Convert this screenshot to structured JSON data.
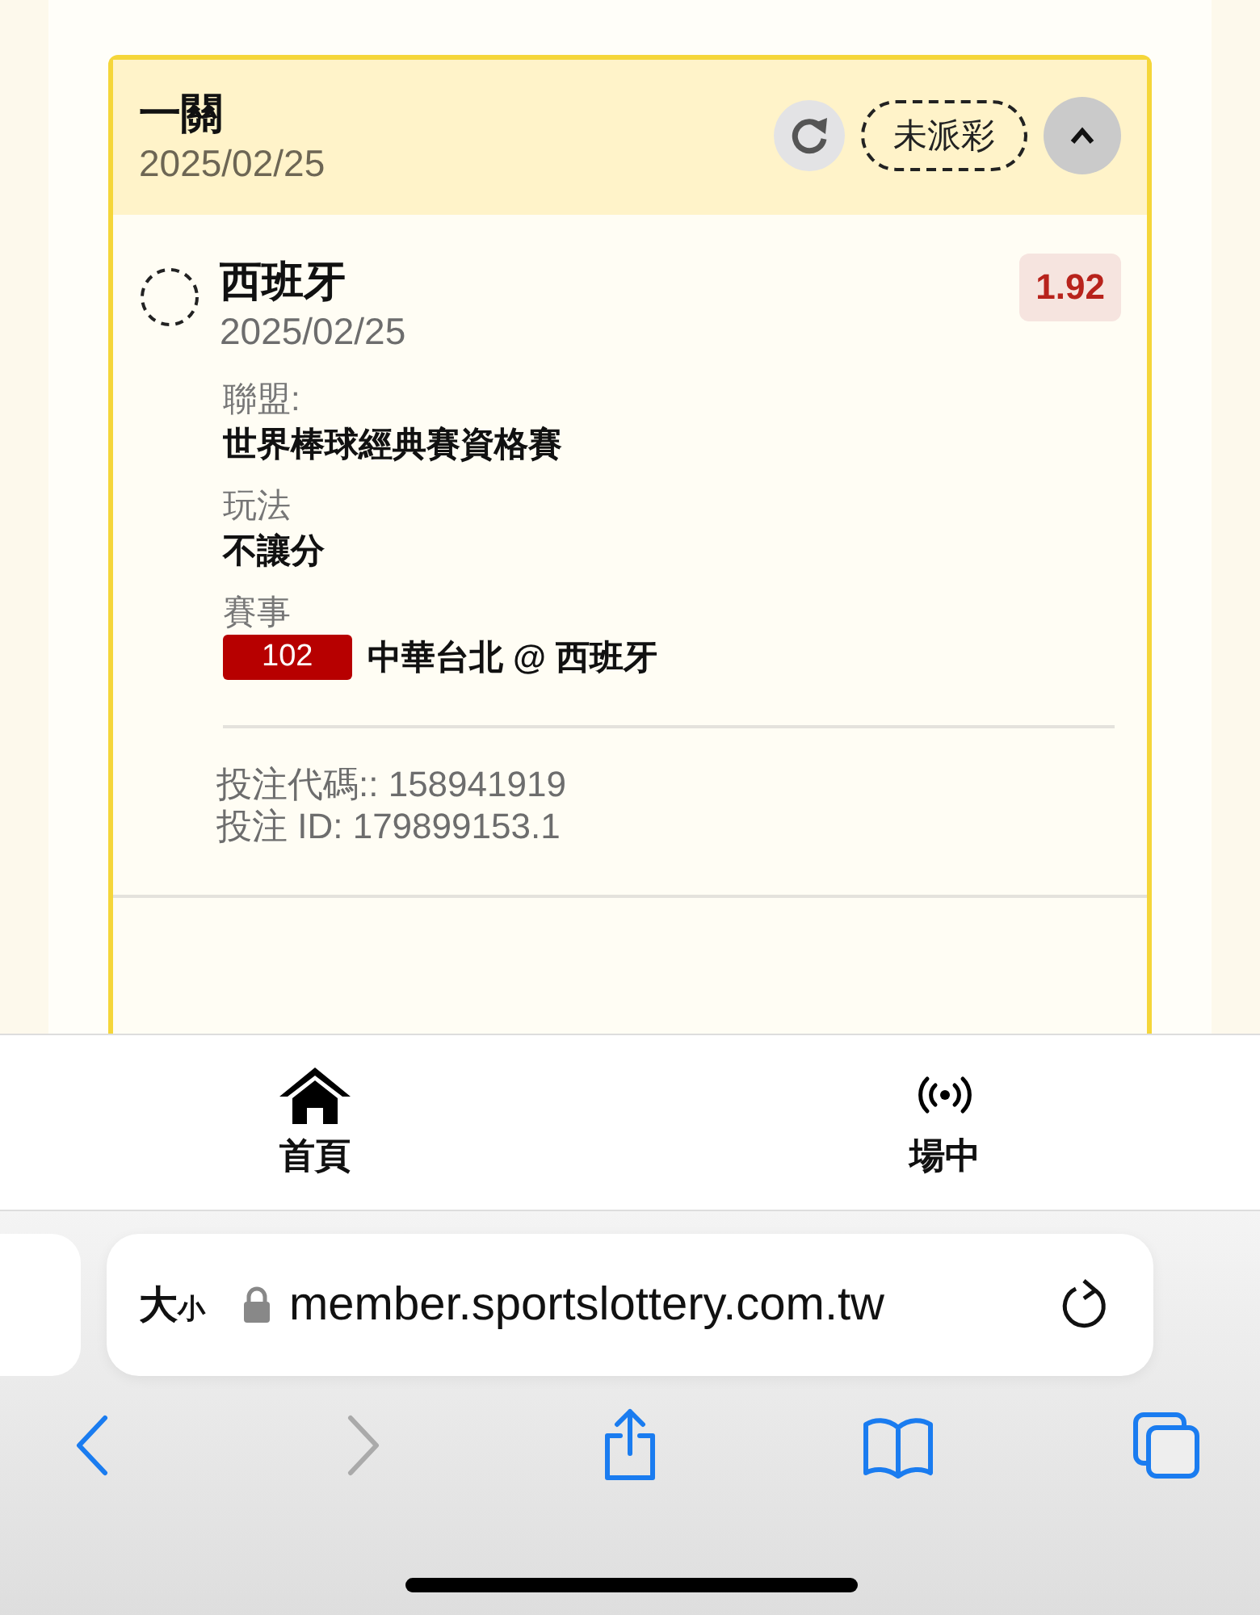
{
  "bet_card": {
    "title": "一關",
    "date": "2025/02/25",
    "status": "未派彩",
    "expanded": true,
    "selection": {
      "checked": false,
      "team": "西班牙",
      "date": "2025/02/25",
      "odds": "1.92",
      "fields": [
        {
          "label": "聯盟:",
          "value": "世界棒球經典賽資格賽"
        },
        {
          "label": "玩法",
          "value": "不讓分"
        },
        {
          "label": "賽事",
          "badge": "102",
          "value": "中華台北 @ 西班牙"
        }
      ]
    },
    "bet_code": "投注代碼:: 158941919",
    "bet_id": "投注 ID: 179899153.1"
  },
  "tab_bar": [
    {
      "kind": "home",
      "label": "首頁"
    },
    {
      "kind": "live",
      "label": "場中"
    }
  ],
  "browser": {
    "text_size": {
      "big": "大",
      "small": "小"
    },
    "url": "member.sportslottery.com.tw",
    "toolbar": [
      {
        "kind": "back",
        "disabled": false
      },
      {
        "kind": "forward",
        "disabled": true
      },
      {
        "kind": "share",
        "disabled": false
      },
      {
        "kind": "bookmarks",
        "disabled": false
      },
      {
        "kind": "tabs",
        "disabled": false
      }
    ]
  }
}
